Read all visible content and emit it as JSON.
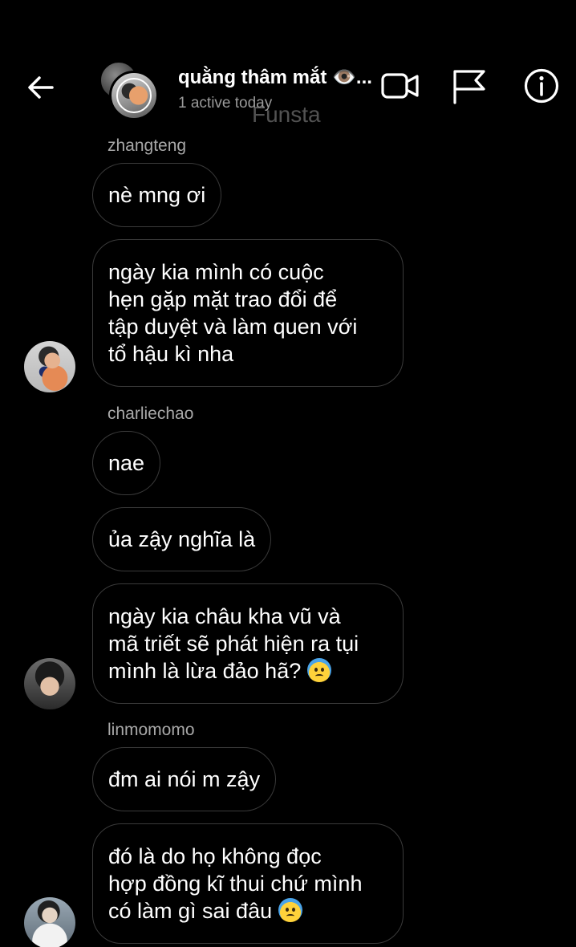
{
  "header": {
    "title": "quằng thâm mắt 👁️...",
    "status": "1 active today",
    "watermark": "Funsta",
    "icons": {
      "back": "back-arrow-icon",
      "video": "video-call-icon",
      "flag": "flag-icon",
      "info": "info-icon"
    }
  },
  "messages": [
    {
      "sender": "zhangteng",
      "bubbles": [
        {
          "lines": [
            "nè mng ơi"
          ]
        },
        {
          "lines": [
            "ngày kia mình có cuộc",
            "hẹn gặp mặt trao đổi để",
            "tập duyệt và làm quen với",
            "tổ hậu kì nha"
          ]
        }
      ]
    },
    {
      "sender": "charliechao",
      "bubbles": [
        {
          "lines": [
            "nae"
          ]
        },
        {
          "lines": [
            "ủa zậy nghĩa là"
          ]
        },
        {
          "lines": [
            "ngày kia châu kha vũ và",
            "mã triết sẽ phát hiện ra tụi",
            "mình là lừa đảo hã?"
          ],
          "emoji": "anxious-face-with-sweat"
        }
      ]
    },
    {
      "sender": "linmomomo",
      "bubbles": [
        {
          "lines": [
            "đm ai nói m zậy"
          ]
        },
        {
          "lines": [
            "đó là do họ không đọc",
            "hợp đồng kĩ thui chứ mình",
            "có làm gì sai đâu"
          ],
          "emoji": "anxious-face-with-sweat"
        }
      ]
    }
  ],
  "colors": {
    "background": "#000000",
    "bubble_border": "#3a3a3a",
    "text": "#ffffff",
    "secondary_text": "#a8a8a8"
  }
}
